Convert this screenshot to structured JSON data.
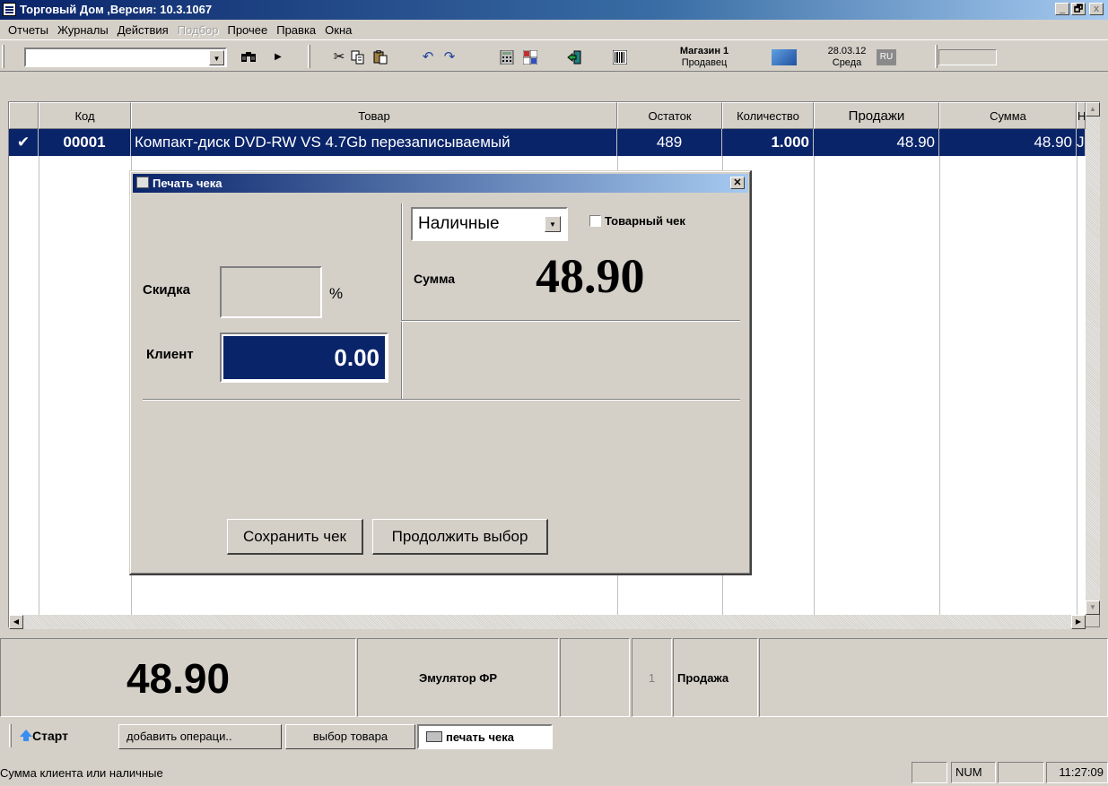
{
  "window": {
    "title": "Торговый Дом ,Версия: 10.3.1067",
    "controls": [
      "_",
      "🗗",
      "x"
    ]
  },
  "menu": [
    "Отчеты",
    "Журналы",
    "Действия",
    "Подбор",
    "Прочее",
    "Правка",
    "Окна"
  ],
  "toolbar": {
    "store_name": "Магазин 1",
    "store_role": "Продавец",
    "date": "28.03.12",
    "weekday": "Среда",
    "lang": "RU"
  },
  "grid": {
    "headers": [
      "",
      "Код",
      "Товар",
      "Остаток",
      "Количество",
      "Продажи",
      "Сумма",
      "Н"
    ],
    "rows": [
      {
        "mark": "✔",
        "code": "00001",
        "product": "Компакт-диск DVD-RW VS 4.7Gb перезаписываемый",
        "stock": "489",
        "qty": "1.000",
        "sales": "48.90",
        "sum": "48.90",
        "extra": "J"
      }
    ]
  },
  "dialog": {
    "title": "Печать чека",
    "discount_label": "Скидка",
    "discount_value": "",
    "percent_sign": "%",
    "client_label": "Клиент",
    "client_value": "0.00",
    "payment_type": "Наличные",
    "goods_receipt_label": "Товарный чек",
    "goods_receipt_checked": false,
    "sum_label": "Сумма",
    "sum_value": "48.90",
    "save_button": "Сохранить чек",
    "continue_button": "Продолжить выбор"
  },
  "bottom": {
    "total": "48.90",
    "fiscal": "Эмулятор ФР",
    "counter": "1",
    "mode": "Продажа"
  },
  "taskbar": {
    "start": "Старт",
    "tasks": [
      "добавить операци..",
      "выбор товара",
      "печать чека"
    ]
  },
  "status": {
    "text": "Сумма клиента или наличные",
    "num": "NUM",
    "time": "11:27:09"
  }
}
